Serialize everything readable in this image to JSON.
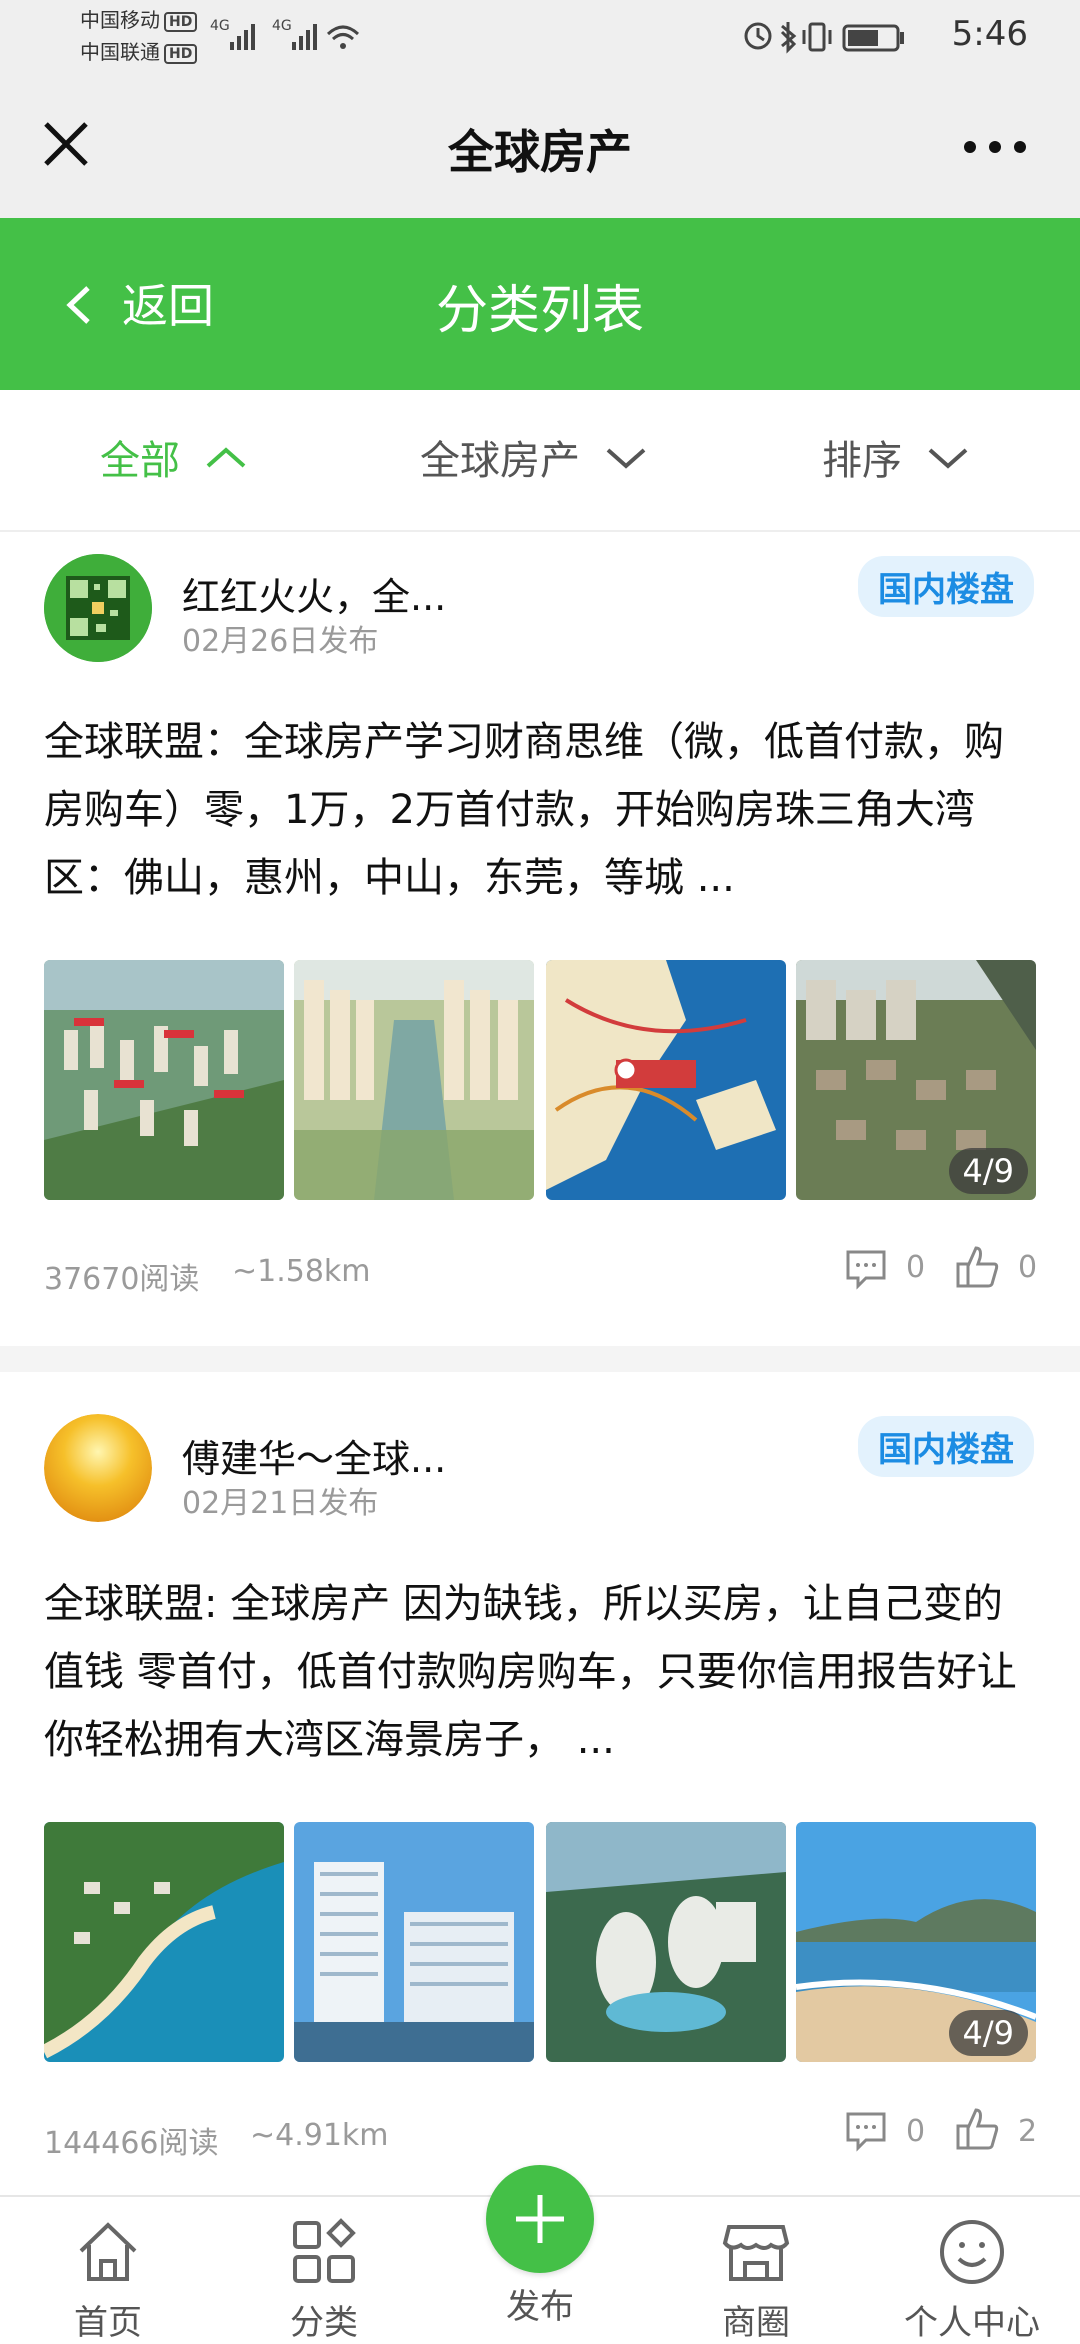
{
  "status_bar": {
    "carrier1": "中国移动",
    "carrier2": "中国联通",
    "hd": "HD",
    "net": "4G",
    "time": "5:46"
  },
  "title_bar": {
    "title": "全球房产",
    "close_icon": "close-icon",
    "more_icon": "more-icon"
  },
  "header": {
    "back_label": "返回",
    "title": "分类列表",
    "accent_color": "#44c047"
  },
  "filters": [
    {
      "label": "全部",
      "state": "expanded"
    },
    {
      "label": "全球房产",
      "state": "collapsed"
    },
    {
      "label": "排序",
      "state": "collapsed"
    }
  ],
  "posts": [
    {
      "author": "红红火火，全...",
      "date": "02月26日发布",
      "tag": "国内楼盘",
      "text": "全球联盟：全球房产学习财商思维（微，低首付款，购房购车）零，1万，2万首付款，开始购房珠三角大湾区：佛山，惠州，中山，东莞，等城 ...",
      "image_count": "4/9",
      "reads": "37670阅读",
      "distance": "~1.58km",
      "comments": "0",
      "likes": "0"
    },
    {
      "author": "傅建华～全球...",
      "date": "02月21日发布",
      "tag": "国内楼盘",
      "text": "全球联盟: 全球房产 因为缺钱，所以买房，让自己变的值钱 零首付，低首付款购房购车，只要你信用报告好让你轻松拥有大湾区海景房子， ...",
      "image_count": "4/9",
      "reads": "144466阅读",
      "distance": "~4.91km",
      "comments": "0",
      "likes": "2"
    }
  ],
  "bottom_nav": [
    {
      "label": "首页",
      "icon": "home-icon"
    },
    {
      "label": "分类",
      "icon": "category-icon"
    },
    {
      "label": "发布",
      "icon": "plus-icon"
    },
    {
      "label": "商圈",
      "icon": "store-icon"
    },
    {
      "label": "个人中心",
      "icon": "profile-icon"
    }
  ]
}
